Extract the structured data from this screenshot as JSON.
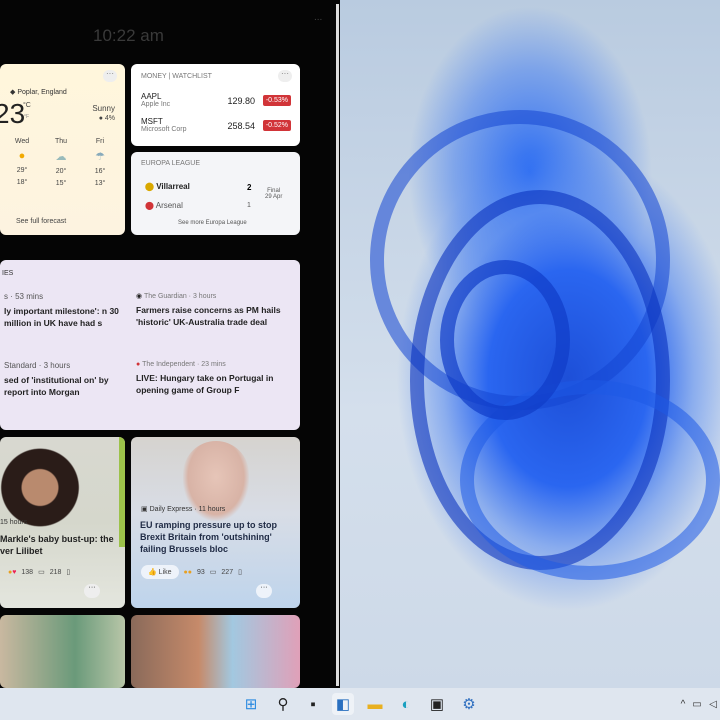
{
  "panel": {
    "time": "10:22 am",
    "more": "..."
  },
  "weather": {
    "location": "Poplar, England",
    "temp": "23",
    "unit": "°C",
    "unit_alt": "°F",
    "condition": "Sunny",
    "precip": "4%",
    "days": [
      {
        "day": "Wed",
        "icon": "sun-icon",
        "hi": "29°",
        "lo": "18°"
      },
      {
        "day": "Thu",
        "icon": "cloud-sun-icon",
        "hi": "20°",
        "lo": "15°"
      },
      {
        "day": "Fri",
        "icon": "rain-icon",
        "hi": "16°",
        "lo": "13°"
      }
    ],
    "link": "See full forecast"
  },
  "money": {
    "title": "MONEY | WATCHLIST",
    "stocks": [
      {
        "sym": "AAPL",
        "name": "Apple Inc",
        "price": "129.80",
        "change": "-0.53%"
      },
      {
        "sym": "MSFT",
        "name": "Microsoft Corp",
        "price": "258.54",
        "change": "-0.52%"
      }
    ]
  },
  "europa": {
    "title": "EUROPA LEAGUE",
    "teams": [
      {
        "name": "Villarreal",
        "score": "2"
      },
      {
        "name": "Arsenal",
        "score": "1"
      }
    ],
    "status": "Final",
    "date": "29 Apr",
    "link": "See more Europa League"
  },
  "stories": {
    "title": "IES",
    "items": [
      {
        "source": "s · 53 mins",
        "headline": "ly important milestone': n 30 million in UK have had s"
      },
      {
        "source": "The Guardian · 3 hours",
        "headline": "Farmers raise concerns as PM hails 'historic' UK-Australia trade deal"
      },
      {
        "source": "Standard · 3 hours",
        "headline": "sed of 'institutional on' by report into Morgan"
      },
      {
        "source": "The Independent · 23 mins",
        "headline": "LIVE: Hungary take on Portugal in opening game of Group F"
      }
    ]
  },
  "cards": [
    {
      "source": "15 hours",
      "headline": "Markle's baby bust-up: the ver Lilibet",
      "reactions": "138",
      "comments": "218"
    },
    {
      "source": "Daily Express · 11 hours",
      "headline": "EU ramping pressure up to stop Brexit Britain from 'outshining' failing Brussels bloc",
      "like": "Like",
      "reactions": "93",
      "comments": "227"
    }
  ],
  "colors": {
    "negative": "#d13438",
    "accent": "#1d4fd8"
  }
}
